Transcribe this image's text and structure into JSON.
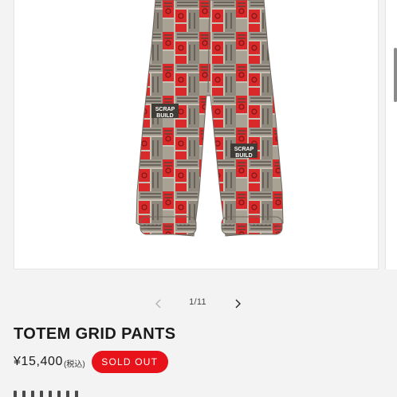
{
  "gallery": {
    "counter": "1/11",
    "prev_icon": "chevron-left-icon",
    "next_icon": "chevron-right-icon",
    "image_subject": "totem-grid-pants",
    "print_words": [
      "SCRAP",
      "BUILD"
    ]
  },
  "product": {
    "title": "TOTEM GRID PANTS",
    "price": "¥15,400",
    "tax_note": "(税込)",
    "badge": "SOLD OUT"
  },
  "colors": {
    "page_background": "#f3f3f3",
    "gallery_background": "#ffffff",
    "badge_background": "#e8121b",
    "badge_text": "#ffffff",
    "print_red": "#d82a2a",
    "print_gray": "#b9b2a6"
  }
}
